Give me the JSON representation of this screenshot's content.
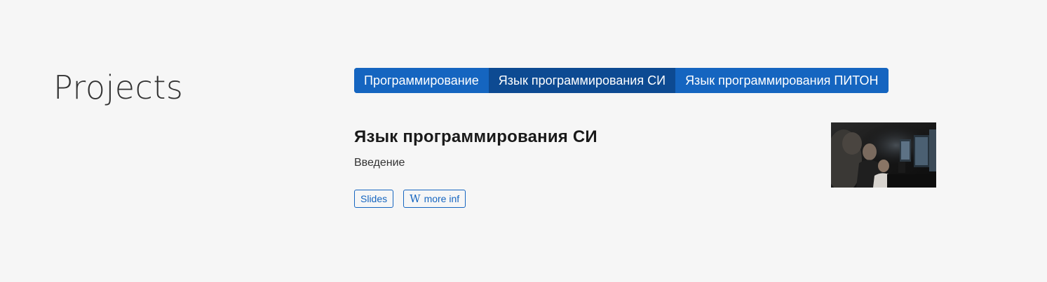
{
  "section": {
    "title": "Projects"
  },
  "tabs": [
    {
      "label": "Программирование",
      "active": false
    },
    {
      "label": "Язык программирования СИ",
      "active": true
    },
    {
      "label": "Язык программирования ПИТОН",
      "active": false
    }
  ],
  "project": {
    "title": "Язык программирования СИ",
    "subtitle": "Введение",
    "links": {
      "slides_label": "Slides",
      "more_label": "more inf",
      "more_icon_glyph": "W",
      "more_icon": "wikipedia-icon"
    },
    "thumbnail": {
      "description_icon": "project-photo"
    }
  },
  "colors": {
    "background": "#f6f6f6",
    "accent": "#1565c0",
    "accent_active": "#0d4a92",
    "text": "#212121"
  }
}
